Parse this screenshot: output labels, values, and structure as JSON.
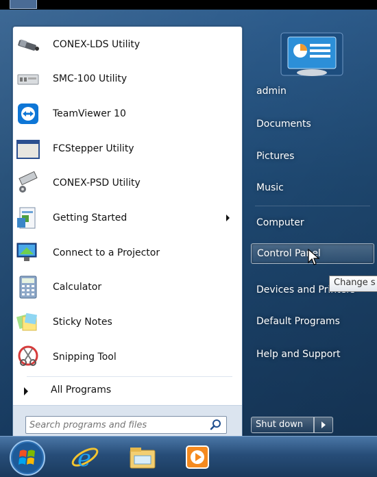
{
  "start_menu": {
    "programs": [
      {
        "label": "CONEX-LDS Utility",
        "icon": "conex-lds-icon",
        "has_submenu": false
      },
      {
        "label": "SMC-100 Utility",
        "icon": "smc100-icon",
        "has_submenu": false
      },
      {
        "label": "TeamViewer 10",
        "icon": "teamviewer-icon",
        "has_submenu": false
      },
      {
        "label": "FCStepper Utility",
        "icon": "fcstepper-icon",
        "has_submenu": false
      },
      {
        "label": "CONEX-PSD Utility",
        "icon": "conex-psd-icon",
        "has_submenu": false
      },
      {
        "label": "Getting Started",
        "icon": "getting-started-icon",
        "has_submenu": true
      },
      {
        "label": "Connect to a Projector",
        "icon": "projector-icon",
        "has_submenu": false
      },
      {
        "label": "Calculator",
        "icon": "calculator-icon",
        "has_submenu": false
      },
      {
        "label": "Sticky Notes",
        "icon": "sticky-notes-icon",
        "has_submenu": false
      },
      {
        "label": "Snipping Tool",
        "icon": "snipping-tool-icon",
        "has_submenu": false
      }
    ],
    "all_programs_label": "All Programs",
    "search": {
      "placeholder": "Search programs and files",
      "value": ""
    },
    "right_items": [
      {
        "label": "admin"
      },
      {
        "label": "Documents"
      },
      {
        "label": "Pictures"
      },
      {
        "label": "Music"
      },
      {
        "label": "Computer"
      },
      {
        "label": "Control Panel"
      },
      {
        "label": "Devices and Printers"
      },
      {
        "label": "Default Programs"
      },
      {
        "label": "Help and Support"
      }
    ],
    "tooltip": "Change s",
    "shutdown_label": "Shut down"
  },
  "taskbar": {
    "items": [
      "start-orb-icon",
      "internet-explorer-icon",
      "file-explorer-icon",
      "media-player-icon"
    ]
  },
  "colors": {
    "glass": "#1f4a74",
    "panel": "#ffffff",
    "taskbar": "#274d78"
  }
}
